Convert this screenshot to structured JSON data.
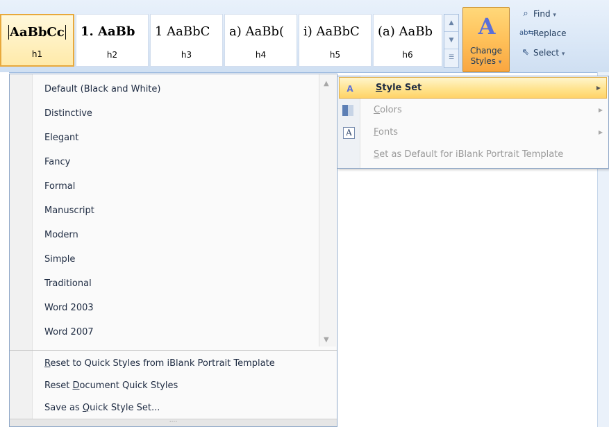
{
  "gallery": {
    "tiles": [
      {
        "sample": "AaBbCc",
        "name": "h1"
      },
      {
        "sample": "1. AaBb",
        "name": "h2"
      },
      {
        "sample": "1 AaBbC",
        "name": "h3"
      },
      {
        "sample": "a) AaBb(",
        "name": "h4"
      },
      {
        "sample": "i) AaBbC",
        "name": "h5"
      },
      {
        "sample": "(a) AaBb",
        "name": "h6"
      }
    ]
  },
  "change_styles": {
    "line1": "Change",
    "line2": "Styles"
  },
  "editing": {
    "find": "Find",
    "replace": "Replace",
    "select": "Select"
  },
  "style_menu": {
    "items": [
      "Default (Black and White)",
      "Distinctive",
      "Elegant",
      "Fancy",
      "Formal",
      "Manuscript",
      "Modern",
      "Simple",
      "Traditional",
      "Word 2003",
      "Word 2007"
    ],
    "footer": {
      "reset_quick_pre": "",
      "reset_quick_ul": "R",
      "reset_quick_post": "eset to Quick Styles from iBlank Portrait Template",
      "reset_doc_pre": "Reset ",
      "reset_doc_ul": "D",
      "reset_doc_post": "ocument Quick Styles",
      "save_pre": "Save as ",
      "save_ul": "Q",
      "save_post": "uick Style Set..."
    },
    "grip": "····"
  },
  "sub_menu": {
    "style_set_ul": "S",
    "style_set_post": "tyle Set",
    "colors_ul": "C",
    "colors_post": "olors",
    "fonts_ul": "F",
    "fonts_post": "onts",
    "default_ul": "S",
    "default_post": "et as Default for iBlank Portrait Template"
  }
}
